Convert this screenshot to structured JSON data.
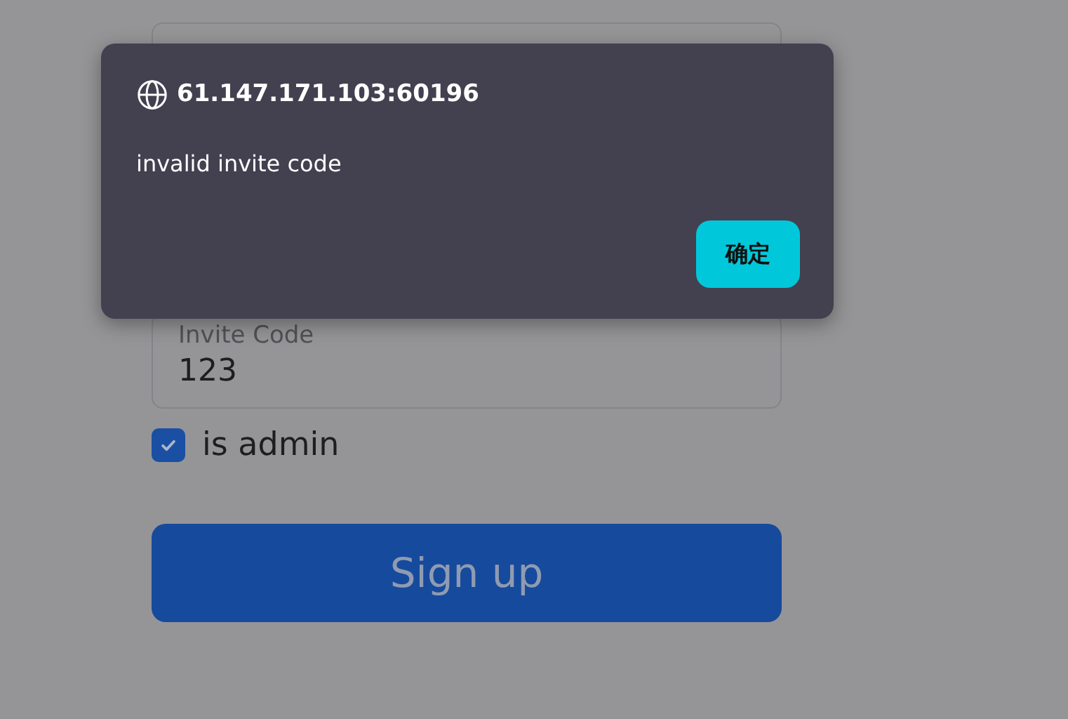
{
  "form": {
    "invite_field": {
      "label": "Invite Code",
      "value": "123"
    },
    "is_admin": {
      "label": "is admin",
      "checked": true
    },
    "submit": "Sign up"
  },
  "dialog": {
    "title": "61.147.171.103:60196",
    "message": "invalid invite code",
    "ok_button": "确定"
  }
}
